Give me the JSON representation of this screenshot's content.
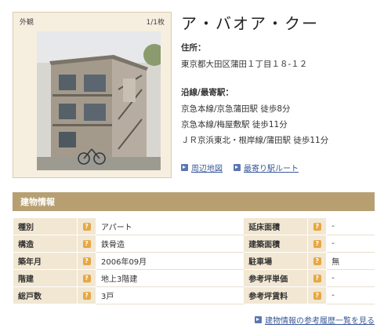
{
  "photo": {
    "label": "外観",
    "counter": "1/1枚"
  },
  "title": "ア・バオア・クー",
  "address": {
    "label": "住所：",
    "value": "東京都大田区蒲田１丁目１８-１２"
  },
  "stations": {
    "label": "沿線/最寄駅：",
    "items": [
      "京急本線/京急蒲田駅 徒歩8分",
      "京急本線/梅屋敷駅 徒歩11分",
      "ＪＲ京浜東北・根岸線/蒲田駅 徒歩11分"
    ]
  },
  "links": {
    "map": "周辺地図",
    "route": "最寄り駅ルート"
  },
  "section_title": "建物情報",
  "table": [
    {
      "k1": "種別",
      "v1": "アパート",
      "k2": "延床面積",
      "v2": "-"
    },
    {
      "k1": "構造",
      "v1": "鉄骨造",
      "k2": "建築面積",
      "v2": "-"
    },
    {
      "k1": "築年月",
      "v1": "2006年09月",
      "k2": "駐車場",
      "v2": "無"
    },
    {
      "k1": "階建",
      "v1": "地上3階建",
      "k2": "参考坪単価",
      "v2": "-"
    },
    {
      "k1": "総戸数",
      "v1": "3戸",
      "k2": "参考坪賃料",
      "v2": "-"
    }
  ],
  "history_link": "建物情報の参考履歴一覧を見る",
  "icons": {
    "help": "?"
  }
}
